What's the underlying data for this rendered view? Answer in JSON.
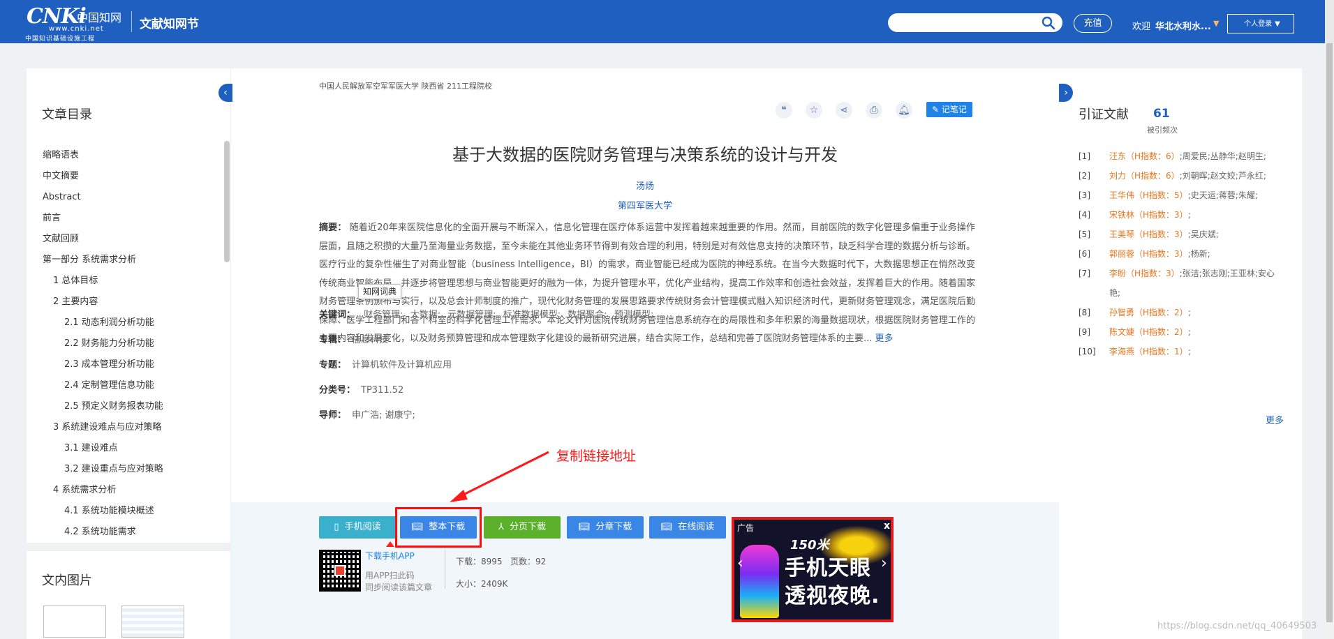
{
  "header": {
    "logo_big": "CNKi",
    "logo_cn": "中国知网",
    "logo_url": "www.cnki.net",
    "logo_sub": "中国知识基础设施工程",
    "site_name": "文献知网节",
    "search_placeholder": "",
    "recharge_label": "充值",
    "welcome": "欢迎",
    "org_name": "华北水利水...",
    "login_label": "个人登录"
  },
  "toc": {
    "title": "文章目录",
    "items": [
      {
        "label": "缩略语表",
        "level": 0
      },
      {
        "label": "中文摘要",
        "level": 0
      },
      {
        "label": "Abstract",
        "level": 0
      },
      {
        "label": "前言",
        "level": 0
      },
      {
        "label": "文献回顾",
        "level": 0
      },
      {
        "label": "第一部分  系统需求分析",
        "level": 0
      },
      {
        "label": "1 总体目标",
        "level": 1
      },
      {
        "label": "2 主要内容",
        "level": 1
      },
      {
        "label": "2.1 动态利润分析功能",
        "level": 2
      },
      {
        "label": "2.2 财务能力分析功能",
        "level": 2
      },
      {
        "label": "2.3 成本管理分析功能",
        "level": 2
      },
      {
        "label": "2.4 定制管理信息功能",
        "level": 2
      },
      {
        "label": "2.5 预定义财务报表功能",
        "level": 2
      },
      {
        "label": "3 系统建设难点与应对策略",
        "level": 1
      },
      {
        "label": "3.1 建设难点",
        "level": 2
      },
      {
        "label": "3.2 建设重点与应对策略",
        "level": 2
      },
      {
        "label": "4 系统需求分析",
        "level": 1
      },
      {
        "label": "4.1 系统功能模块概述",
        "level": 2
      },
      {
        "label": "4.2 系统功能需求",
        "level": 2
      }
    ],
    "figures_title": "文内图片"
  },
  "article": {
    "top_orgs": "中国人民解放军空军军医大学  陕西省 211工程院校",
    "note_label": "记笔记",
    "title": "基于大数据的医院财务管理与决策系统的设计与开发",
    "author": "汤炀",
    "affiliation": "第四军医大学",
    "abstract_label": "摘要：",
    "abstract_text": "随着近20年来医院信息化的全面开展与不断深入，信息化管理在医疗体系运营中发挥着越来越重要的作用。然而，目前医院的数字化管理多偏重于业务操作层面，且随之积攒的大量乃至海量业务数据，至今未能在其他业务环节得到有效合理的利用，特别是对有效信息支持的决策环节，缺乏科学合理的数据分析与诊断。医疗行业的复杂性催生了对商业智能（business Intelligence，BI）的需求，商业智能已经成为医院的神经系统。在当今大数据时代下，大数据思想正在悄然改变传统商业智能布局，并逐步将管理思想与商业智能更好的融为一体，为提升管理水平，优化产业结构，提高工作效率和创造社会效益，发挥着巨大的作用。随着国家财务管理条例颁布与实行，以及总会计师制度的推广，现代化财务管理的发展思路要求传统财务会计管理模式融入知识经济时代，更新财务管理观念，满足医院后勤保障、医学工程部门和各个科室的科学化管理工作需求。本论文针对医院传统财务管理信息系统存在的局限性和多年积累的海量数据现状，根据医院财务管理工作的主要内容和发展变化，以及财务预算管理和成本管理数字化建设的最新研究进展，结合实际工作，总结和完善了医院财务管理体系的主要...",
    "more_label": "更多",
    "dict_tooltip": "知网词典",
    "keywords_label": "关键词：",
    "keywords": [
      "财务管理;",
      "大数据;",
      "元数据管理;",
      "标准数据模型;",
      "数据聚合;",
      "预测模型;"
    ],
    "series_label": "专辑：",
    "series": "信息科技",
    "topic_label": "专题：",
    "topic": "计算机软件及计算机应用",
    "class_label": "分类号：",
    "class_no": "TP311.52",
    "advisor_label": "导师：",
    "advisor": "申广浩; 谢康宁;"
  },
  "actions": {
    "mobile_read": "手机阅读",
    "full_download": "整本下载",
    "page_download": "分页下载",
    "chapter_download": "分章下载",
    "online_read": "在线阅读",
    "app_link": "下载手机APP",
    "app_hint1": "用APP扫此码",
    "app_hint2": "同步阅读该篇文章",
    "downloads": "下载：8995",
    "pages": "页数：92",
    "size": "大小：2409K"
  },
  "ad": {
    "tag": "广告",
    "close": "x",
    "line1": "150米",
    "line2a": "手机天眼",
    "line2b": "透视夜晚."
  },
  "citations": {
    "title": "引证文献",
    "count": "61",
    "count_label": "被引频次",
    "items": [
      {
        "idx": "[1]",
        "author": "汪东",
        "h": "（H指数：6）",
        "rest": ";周爱民;丛静华;赵明生;"
      },
      {
        "idx": "[2]",
        "author": "刘力",
        "h": "（H指数：6）",
        "rest": ";刘朝晖;赵文姣;芦永红;"
      },
      {
        "idx": "[3]",
        "author": "王华伟",
        "h": "（H指数：5）",
        "rest": ";史天运;蒋蓉;朱耀;"
      },
      {
        "idx": "[4]",
        "author": "宋铁林",
        "h": "（H指数：3）",
        "rest": ";"
      },
      {
        "idx": "[5]",
        "author": "王美琴",
        "h": "（H指数：3）",
        "rest": ";吴庆斌;"
      },
      {
        "idx": "[6]",
        "author": "郭丽蓉",
        "h": "（H指数：3）",
        "rest": ";杨新;"
      },
      {
        "idx": "[7]",
        "author": "李盼",
        "h": "（H指数：3）",
        "rest": ";张洁;张志刚;王亚林;安心艳;"
      },
      {
        "idx": "[8]",
        "author": "孙智勇",
        "h": "（H指数：2）",
        "rest": ";"
      },
      {
        "idx": "[9]",
        "author": "陈文婕",
        "h": "（H指数：2）",
        "rest": ";"
      },
      {
        "idx": "[10]",
        "author": "李海燕",
        "h": "（H指数：1）",
        "rest": ";"
      }
    ],
    "more_label": "更多"
  },
  "annotation": {
    "text": "复制链接地址",
    "color": "#ff1a1a"
  },
  "watermark": "https://blog.csdn.net/qq_40649503",
  "colors": {
    "brand_blue": "#1e5fc0",
    "btn_teal": "#3ab0cc",
    "btn_blue": "#3a86e6",
    "btn_green": "#5bb02c"
  }
}
